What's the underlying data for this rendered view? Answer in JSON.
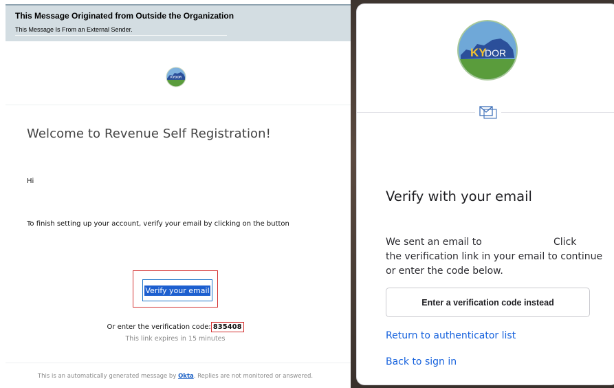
{
  "email": {
    "banner": {
      "title": "This Message Originated from Outside the Organization",
      "subtitle": "This Message Is From an External Sender."
    },
    "logo": {
      "name": "KYDOR logo",
      "text": "KYDOR"
    },
    "heading": "Welcome to Revenue Self Registration!",
    "greeting": "Hi",
    "instructions": "To finish setting up your account, verify your email by clicking on the button",
    "verify_button_label": "Verify your email",
    "code_prefix": "Or enter the verification code:",
    "code": "835408",
    "expiry_note": "This link expires in 15 minutes",
    "footer_prefix": "This is an automatically generated message by",
    "footer_link": "Okta",
    "footer_suffix": ". Replies are not monitored or answered.",
    "colors": {
      "banner_bg": "#d3dde2",
      "highlight": "#d32f2f",
      "button_text_bg": "#1d5fcf",
      "link": "#1a5fc4"
    }
  },
  "okta_widget": {
    "logo": {
      "name": "KYDOR logo",
      "text_ky": "KY",
      "text_dor": "DOR"
    },
    "authenticator_icon": "envelope-icon",
    "title": "Verify with your email",
    "body": {
      "line1": "We sent an email to",
      "click": "Click",
      "line2": "the verification link in your email to continue",
      "line3": "or enter the code below."
    },
    "enter_code_button": "Enter a verification code instead",
    "return_link": "Return to authenticator list",
    "back_link": "Back to sign in",
    "colors": {
      "link": "#1662dd",
      "logo_green": "#5a9c3c",
      "logo_blue": "#2b4f9a",
      "logo_sky": "#6fa8d8"
    }
  }
}
